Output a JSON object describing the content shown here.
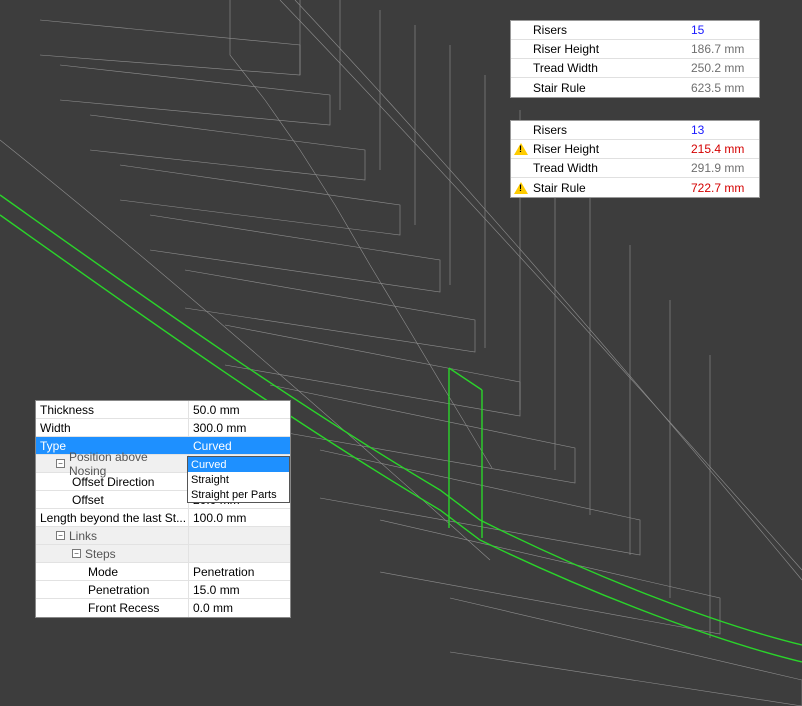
{
  "info_top": {
    "rows": [
      {
        "label": "Risers",
        "value": "15",
        "style": "blue",
        "warn": false
      },
      {
        "label": "Riser Height",
        "value": "186.7 mm",
        "style": "",
        "warn": false
      },
      {
        "label": "Tread Width",
        "value": "250.2 mm",
        "style": "",
        "warn": false
      },
      {
        "label": "Stair Rule",
        "value": "623.5 mm",
        "style": "",
        "warn": false
      }
    ]
  },
  "info_bottom": {
    "rows": [
      {
        "label": "Risers",
        "value": "13",
        "style": "blue",
        "warn": false
      },
      {
        "label": "Riser Height",
        "value": "215.4 mm",
        "style": "red",
        "warn": true
      },
      {
        "label": "Tread Width",
        "value": "291.9 mm",
        "style": "",
        "warn": false
      },
      {
        "label": "Stair Rule",
        "value": "722.7 mm",
        "style": "red",
        "warn": true
      }
    ]
  },
  "props": {
    "thickness": {
      "label": "Thickness",
      "value": "50.0 mm"
    },
    "width": {
      "label": "Width",
      "value": "300.0 mm"
    },
    "type": {
      "label": "Type",
      "value": "Curved"
    },
    "position_above_nosing": {
      "label": "Position above Nosing"
    },
    "offset_direction": {
      "label": "Offset Direction",
      "value": ""
    },
    "offset": {
      "label": "Offset",
      "value": "20.0 mm"
    },
    "length_beyond_last": {
      "label": "Length beyond the last St...",
      "value": "100.0 mm"
    },
    "links": {
      "label": "Links"
    },
    "steps": {
      "label": "Steps"
    },
    "mode": {
      "label": "Mode",
      "value": "Penetration"
    },
    "penetration": {
      "label": "Penetration",
      "value": "15.0 mm"
    },
    "front_recess": {
      "label": "Front Recess",
      "value": "0.0 mm"
    }
  },
  "dropdown": {
    "options": [
      "Curved",
      "Straight",
      "Straight per Parts"
    ],
    "selected_index": 0
  },
  "toggler_glyph": "−"
}
